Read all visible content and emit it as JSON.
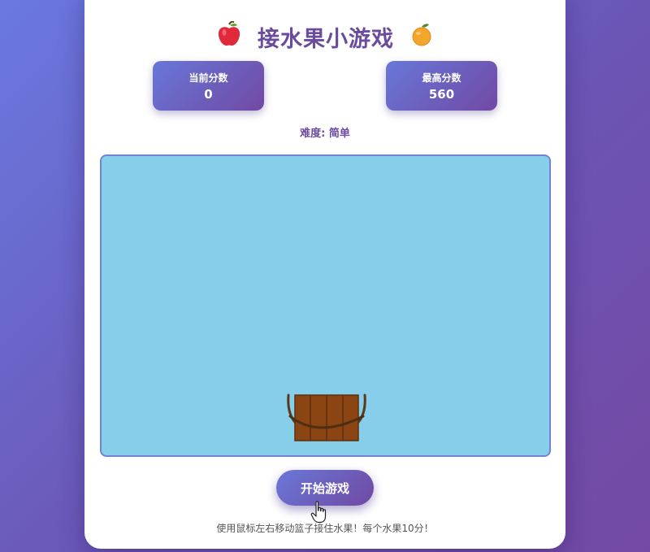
{
  "header": {
    "title": "接水果小游戏",
    "left_icon": "apple-icon",
    "right_icon": "orange-icon"
  },
  "scores": {
    "current_label": "当前分数",
    "current_value": "0",
    "high_label": "最高分数",
    "high_value": "560"
  },
  "difficulty": {
    "text": "难度: 简单"
  },
  "game_area": {
    "background_color": "#87ceeb",
    "basket_icon": "basket-icon"
  },
  "controls": {
    "start_label": "开始游戏"
  },
  "footer": {
    "instructions": "使用鼠标左右移动篮子接住水果！每个水果10分！"
  },
  "colors": {
    "accent": "#6a4b9e",
    "gradient_start": "#6a78d8",
    "gradient_end": "#7049a3"
  }
}
